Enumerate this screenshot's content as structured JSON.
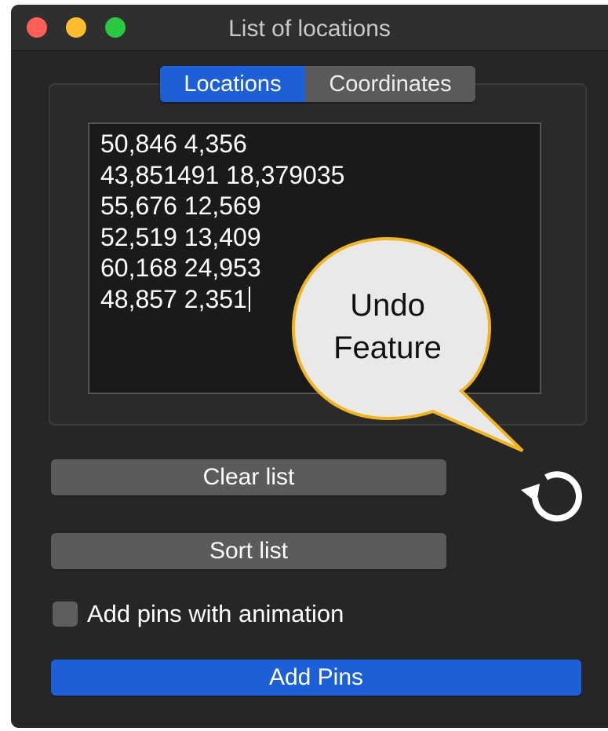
{
  "window": {
    "title": "List of locations"
  },
  "tabs": [
    {
      "label": "Locations",
      "active": true
    },
    {
      "label": "Coordinates",
      "active": false
    }
  ],
  "locations_text": [
    "50,846 4,356",
    "43,851491 18,379035",
    "55,676 12,569",
    "52,519 13,409",
    "60,168 24,953",
    "48,857 2,351"
  ],
  "buttons": {
    "clear": "Clear list",
    "sort": "Sort list",
    "add_pins": "Add Pins"
  },
  "checkbox": {
    "label": "Add pins with animation",
    "checked": false
  },
  "undo_icon": "undo-icon",
  "callout": {
    "line1": "Undo",
    "line2": "Feature"
  },
  "colors": {
    "accent": "#1c5fd6",
    "window_bg": "#262626",
    "callout_fill": "#e9e9e9",
    "callout_stroke": "#f2b51f"
  }
}
